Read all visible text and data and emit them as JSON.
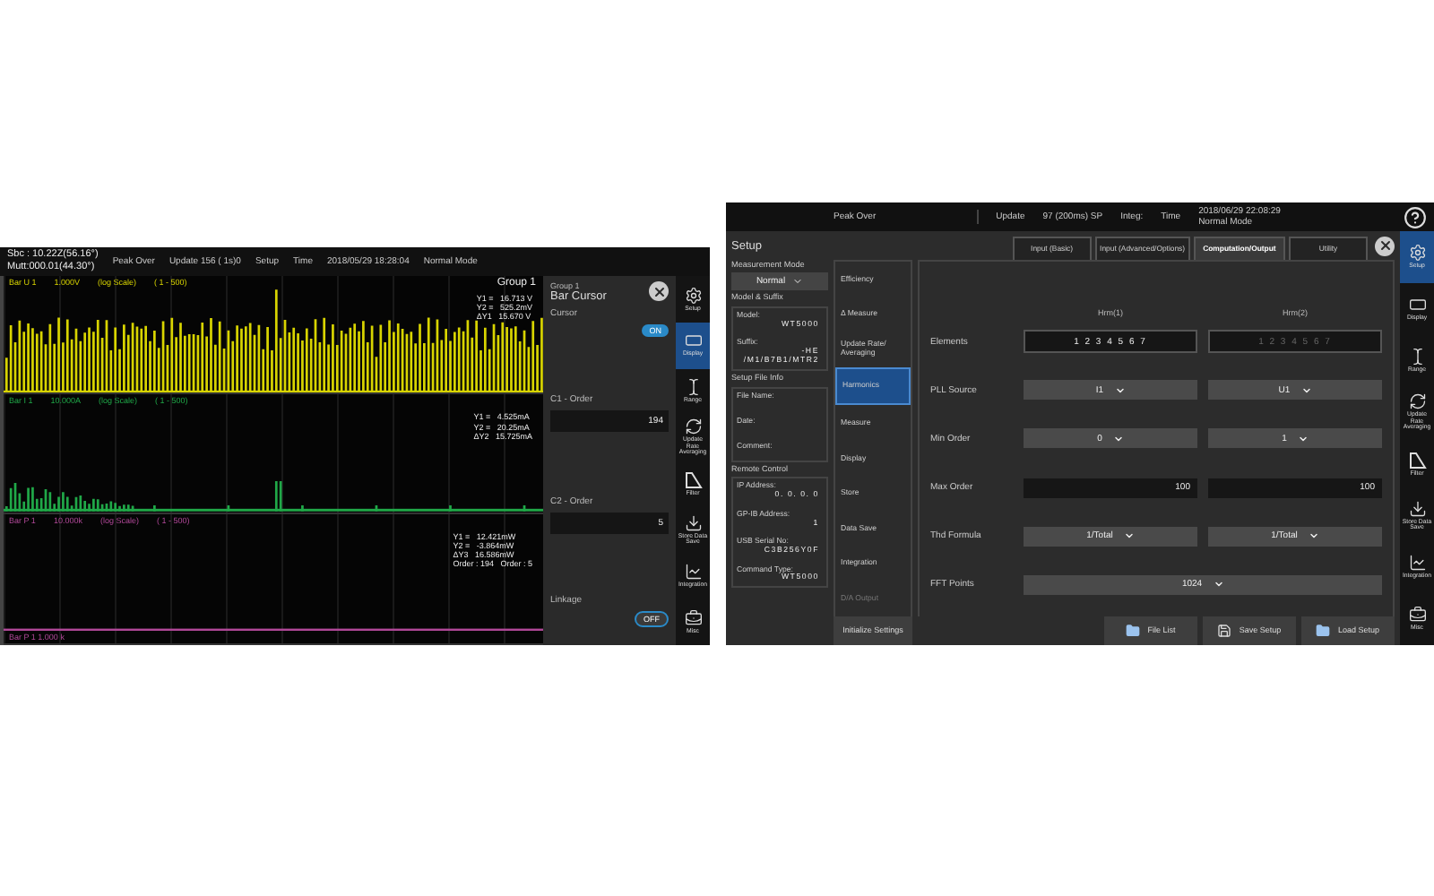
{
  "left_screen": {
    "status": {
      "line_1": "Sbc : 10.22Z(56.16°)",
      "line_2": "Mutt:000.01(44.30°)",
      "items": [
        "Peak Over",
        "Update 156 ( 1s)0",
        "Setup",
        "Time",
        "2018/05/29 18:28:04",
        "Normal Mode"
      ]
    },
    "plots": [
      {
        "header": [
          "Bar U 1",
          "1.000V",
          "(log Scale)",
          "( 1 - 500)"
        ],
        "color": "#d8d400",
        "readings": [
          "Y1 =   16.713 V",
          "Y2 =   525.2mV",
          "ΔY1   15.670 V"
        ],
        "title": "Group 1"
      },
      {
        "header": [
          "Bar I 1",
          "10.000A",
          "(log Scale)",
          "( 1 - 500)"
        ],
        "color": "#20a848",
        "readings": [
          "Y1 =   4.525mA",
          "Y2 =   20.25mA",
          "ΔY2   15.725mA"
        ]
      },
      {
        "header": [
          "Bar P 1",
          "10.000k",
          "(log Scale)",
          "( 1 - 500)"
        ],
        "color": "#b04898",
        "readings": [
          "Y1 =   12.421mW",
          "Y2 =   -3.864mW",
          "ΔY3   16.586mW",
          "Order : 194   Order : 5"
        ],
        "footer": "Bar P 1   1.000 k"
      }
    ],
    "cursor_panel": {
      "group": "Group 1",
      "title": "Bar Cursor",
      "cursor_label": "Cursor",
      "cursor_toggle": {
        "text": "ON",
        "on": true
      },
      "c1_label": "C1 - Order",
      "c1_value": "194",
      "c2_label": "C2 - Order",
      "c2_value": "5",
      "linkage_label": "Linkage",
      "linkage_toggle": {
        "text": "OFF",
        "on": false
      }
    },
    "side_menu": [
      {
        "label": "Setup",
        "kind": "setup",
        "selected": false
      },
      {
        "label": "Display",
        "kind": "display",
        "selected": true
      },
      {
        "label": "Range",
        "kind": "range",
        "selected": false
      },
      {
        "label": "Update Rate Averaging",
        "kind": "averaging",
        "selected": false
      },
      {
        "label": "Filter",
        "kind": "filter",
        "selected": false
      },
      {
        "label": "Store Data Save",
        "kind": "store",
        "selected": false
      },
      {
        "label": "Integration",
        "kind": "integration",
        "selected": false
      },
      {
        "label": "Misc",
        "kind": "misc",
        "selected": false
      }
    ]
  },
  "right_screen": {
    "status": {
      "peak_over": "Peak Over",
      "update_label": "Update",
      "update_value": "97 (200ms) SP",
      "integ": "Integ:",
      "time": "Time",
      "date": "2018/06/29 22:08:29",
      "mode": "Normal Mode"
    },
    "title": "Setup",
    "tabs": [
      {
        "label": "Input (Basic)",
        "selected": false
      },
      {
        "label": "Input (Advanced/Options)",
        "selected": false
      },
      {
        "label": "Computation/Output",
        "selected": true
      },
      {
        "label": "Utility",
        "selected": false
      }
    ],
    "info": {
      "mode_label": "Measurement Mode",
      "mode_value": "Normal",
      "groups": [
        {
          "title": "Model & Suffix",
          "fields": [
            {
              "label": "Model:",
              "value": "WT5000"
            },
            {
              "label": "Suffix:",
              "value": "-HE /M1/B7B1/MTR2"
            }
          ]
        },
        {
          "title": "Setup File Info",
          "fields": [
            {
              "label": "File Name:"
            },
            {
              "label": "Date:"
            },
            {
              "label": "Comment:"
            }
          ]
        },
        {
          "title": "Remote Control",
          "fields": [
            {
              "label": "IP Address:",
              "value": "0. 0. 0. 0"
            },
            {
              "label": "GP-IB Address:",
              "value": "1"
            },
            {
              "label": "USB Serial No:",
              "value": "C3B256Y0F"
            },
            {
              "label": "Command Type:",
              "value": "WT5000"
            }
          ]
        }
      ]
    },
    "menu": [
      {
        "label": "Efficiency",
        "selected": false,
        "disabled": false
      },
      {
        "label": "Δ Measure",
        "selected": false,
        "disabled": false
      },
      {
        "label": "Update Rate/ Averaging",
        "selected": false,
        "disabled": false
      },
      {
        "label": "Harmonics",
        "selected": true,
        "disabled": false
      },
      {
        "label": "Measure",
        "selected": false,
        "disabled": false
      },
      {
        "label": "Display",
        "selected": false,
        "disabled": false
      },
      {
        "label": "Store",
        "selected": false,
        "disabled": false
      },
      {
        "label": "Data Save",
        "selected": false,
        "disabled": false
      },
      {
        "label": "Integration",
        "selected": false,
        "disabled": false
      },
      {
        "label": "D/A Output",
        "selected": false,
        "disabled": true
      }
    ],
    "columns": [
      "Hrm(1)",
      "Hrm(2)"
    ],
    "rows": [
      {
        "label": "Elements",
        "kind": "elements",
        "cells": [
          {
            "text": "1 2 3 4 5 6 7",
            "disabled": false
          },
          {
            "text": "1 2 3 4 5 6 7",
            "disabled": true
          }
        ]
      },
      {
        "label": "PLL Source",
        "kind": "select",
        "cells": [
          {
            "text": "I1",
            "disabled": false
          },
          {
            "text": "U1",
            "disabled": false
          }
        ]
      },
      {
        "label": "Min Order",
        "kind": "select",
        "cells": [
          {
            "text": "0",
            "disabled": false
          },
          {
            "text": "1",
            "disabled": false
          }
        ]
      },
      {
        "label": "Max Order",
        "kind": "number",
        "cells": [
          {
            "text": "100",
            "disabled": false
          },
          {
            "text": "100",
            "disabled": false
          }
        ]
      },
      {
        "label": "Thd Formula",
        "kind": "select",
        "cells": [
          {
            "text": "1/Total",
            "disabled": false
          },
          {
            "text": "1/Total",
            "disabled": false
          }
        ]
      },
      {
        "label": "FFT Points",
        "kind": "wide_select",
        "cells": [
          {
            "text": "1024",
            "disabled": false
          }
        ]
      }
    ],
    "initialize": "Initialize Settings",
    "file_buttons": [
      "File List",
      "Save Setup",
      "Load Setup"
    ],
    "side_menu": [
      {
        "label": "Setup",
        "kind": "setup",
        "selected": true
      },
      {
        "label": "Display",
        "kind": "display",
        "selected": false
      },
      {
        "label": "Range",
        "kind": "range",
        "selected": false
      },
      {
        "label": "Update Rate Averaging",
        "kind": "averaging",
        "selected": false
      },
      {
        "label": "Filter",
        "kind": "filter",
        "selected": false
      },
      {
        "label": "Store Data Save",
        "kind": "store",
        "selected": false
      },
      {
        "label": "Integration",
        "kind": "integration",
        "selected": false
      },
      {
        "label": "Misc",
        "kind": "misc",
        "selected": false
      }
    ]
  }
}
